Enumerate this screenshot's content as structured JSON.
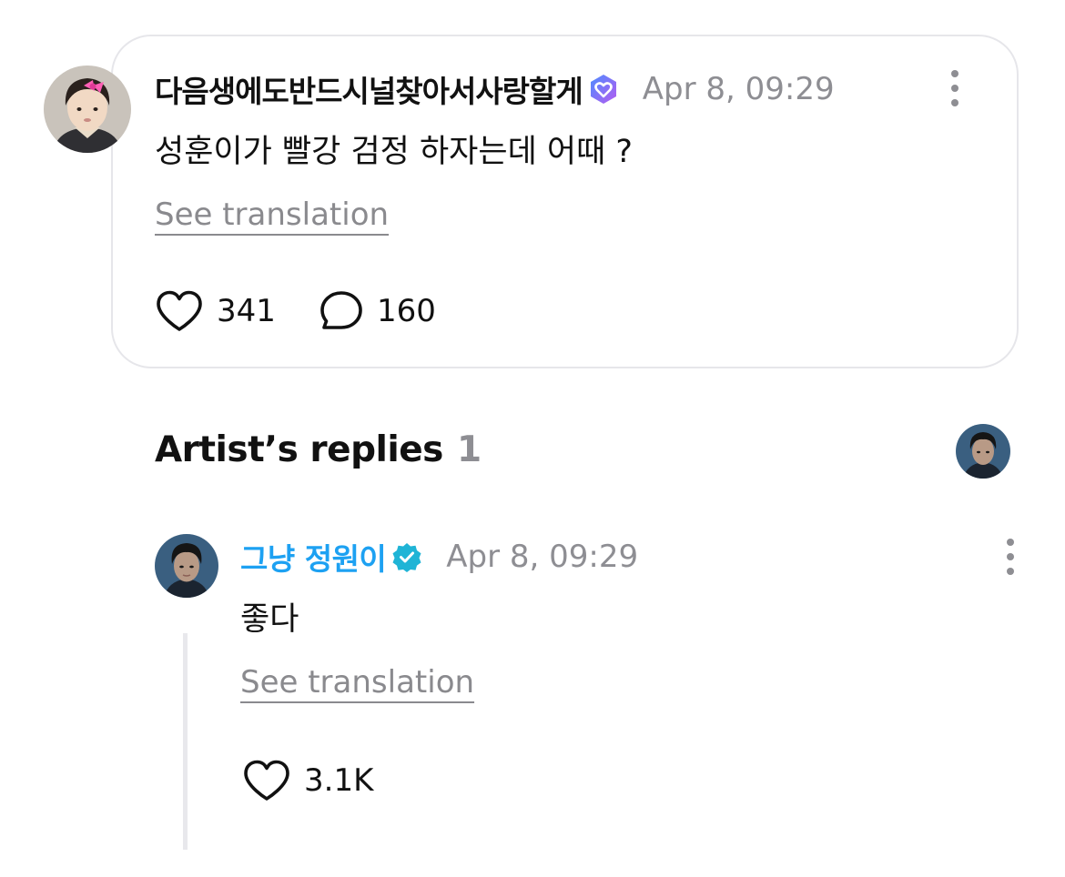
{
  "post": {
    "username": "다음생에도반드시널찾아서사랑할게",
    "timestamp": "Apr 8, 09:29",
    "text": "성훈이가 빨강 검정 하자는데 어때 ?",
    "translate_label": "See translation",
    "likes": "341",
    "comments": "160",
    "badge_icon": "verified-heart-icon",
    "more_icon": "more-vertical-icon"
  },
  "artist_replies": {
    "title": "Artist’s replies",
    "count": "1"
  },
  "reply": {
    "username": "그냥 정원이",
    "timestamp": "Apr 8, 09:29",
    "text": "좋다",
    "translate_label": "See translation",
    "likes": "3.1K",
    "badge_icon": "verified-check-icon",
    "more_icon": "more-vertical-icon"
  },
  "colors": {
    "artist_name": "#1da1f2",
    "meta_gray": "#8e8e93",
    "card_border": "#e6e6ea",
    "fan_badge_gradient": [
      "#4f8cff",
      "#b45cf0"
    ],
    "artist_badge": "#1fb4d6"
  }
}
